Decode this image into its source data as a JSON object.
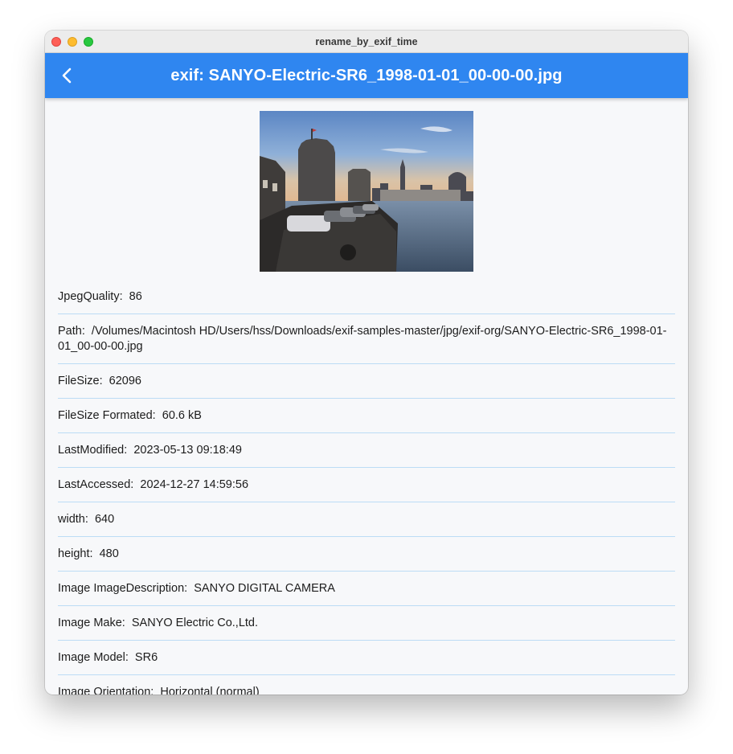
{
  "window": {
    "title": "rename_by_exif_time"
  },
  "appbar": {
    "title": "exif: SANYO-Electric-SR6_1998-01-01_00-00-00.jpg",
    "back_icon": "chevron-left-icon"
  },
  "photo": {
    "description": "Harbor at dusk with stone towers, parked cars and water"
  },
  "colors": {
    "appbar": "#2f86f0",
    "divider": "#bcdcf5",
    "background": "#f7f8fa"
  },
  "rows": [
    {
      "key": "JpegQuality:",
      "value": "86"
    },
    {
      "key": "Path:",
      "value": "/Volumes/Macintosh HD/Users/hss/Downloads/exif-samples-master/jpg/exif-org/SANYO-Electric-SR6_1998-01-01_00-00-00.jpg"
    },
    {
      "key": "FileSize:",
      "value": "62096"
    },
    {
      "key": "FileSize Formated:",
      "value": "60.6 kB"
    },
    {
      "key": "LastModified:",
      "value": "2023-05-13 09:18:49"
    },
    {
      "key": "LastAccessed:",
      "value": "2024-12-27 14:59:56"
    },
    {
      "key": "width:",
      "value": "640"
    },
    {
      "key": "height:",
      "value": "480"
    },
    {
      "key": "Image ImageDescription:",
      "value": "SANYO DIGITAL CAMERA"
    },
    {
      "key": "Image Make:",
      "value": "SANYO Electric Co.,Ltd."
    },
    {
      "key": "Image Model:",
      "value": "SR6"
    },
    {
      "key": "Image Orientation:",
      "value": "Horizontal (normal)"
    }
  ]
}
